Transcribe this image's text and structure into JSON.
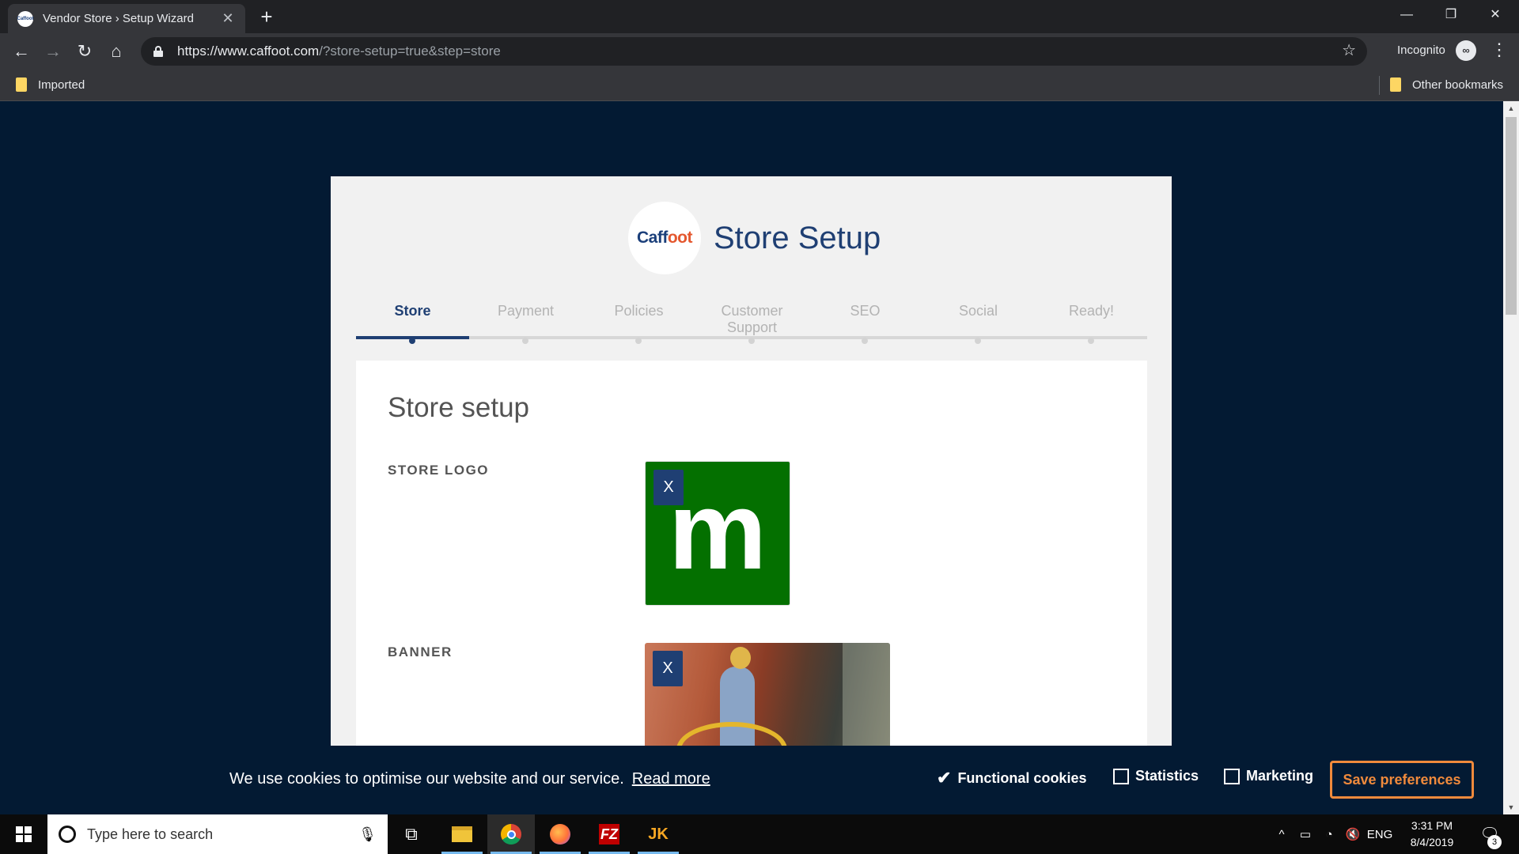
{
  "browser": {
    "tab_title": "Vendor Store › Setup Wizard",
    "tab_favicon_text": "Caffoot",
    "new_tab_label": "+",
    "url_host": "https://www.caffoot.com",
    "url_path": "/?store-setup=true&step=store",
    "incognito_label": "Incognito",
    "bookmarks": {
      "left": "Imported",
      "right": "Other bookmarks"
    },
    "icons": [
      "back-icon",
      "forward-icon",
      "reload-icon",
      "home-icon",
      "lock-icon",
      "star-icon",
      "incognito-icon",
      "menu-icon"
    ]
  },
  "wizard": {
    "brand_prefix": "Caff",
    "brand_accent": "oot",
    "title": "Store Setup",
    "steps": [
      {
        "label": "Store",
        "active": true
      },
      {
        "label": "Payment",
        "active": false
      },
      {
        "label": "Policies",
        "active": false
      },
      {
        "label": "Customer Support",
        "active": false
      },
      {
        "label": "SEO",
        "active": false
      },
      {
        "label": "Social",
        "active": false
      },
      {
        "label": "Ready!",
        "active": false
      }
    ],
    "panel_title": "Store setup",
    "store_logo_label": "STORE LOGO",
    "store_logo_letter": "m",
    "banner_label": "BANNER",
    "remove_label": "X",
    "colors": {
      "accent": "#1f3f73",
      "logo_bg": "#047000",
      "page_bg": "#031a33"
    }
  },
  "cookies": {
    "text": "We use cookies to optimise our website and our service.",
    "read_more": "Read more",
    "options": [
      {
        "label": "Functional cookies",
        "checked": true
      },
      {
        "label": "Statistics",
        "checked": false
      },
      {
        "label": "Marketing",
        "checked": false
      }
    ],
    "save_label": "Save preferences",
    "save_color": "#f08a3c"
  },
  "taskbar": {
    "search_placeholder": "Type here to search",
    "language": "ENG",
    "time": "3:31 PM",
    "date": "8/4/2019",
    "notification_count": "3",
    "filezilla_letters": "FZ",
    "jk_letters": "JK"
  }
}
